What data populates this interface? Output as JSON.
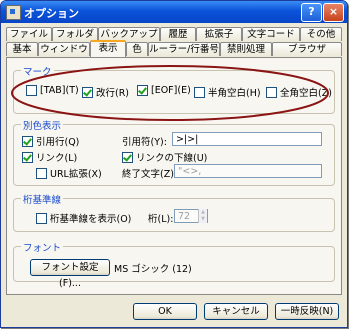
{
  "window": {
    "title": "オプション",
    "help_btn": "?",
    "close_btn": "×"
  },
  "tabs_row1": [
    "ファイル",
    "フォルダ",
    "バックアップ",
    "履歴",
    "拡張子",
    "文字コード",
    "その他"
  ],
  "tabs_row2": [
    "基本",
    "ウィンドウ",
    "表示",
    "色",
    "ルーラー/行番号",
    "禁則処理",
    "ブラウザ"
  ],
  "active_tab": "表示",
  "mark": {
    "legend": "マーク",
    "items": [
      {
        "label": "[TAB](T)",
        "checked": false
      },
      {
        "label": "改行(R)",
        "checked": true
      },
      {
        "label": "[EOF](E)",
        "checked": true
      },
      {
        "label": "半角空白(H)",
        "checked": false
      },
      {
        "label": "全角空白(Z)",
        "checked": false
      }
    ]
  },
  "color": {
    "legend": "別色表示",
    "quote_line": "引用行(Q)",
    "quote_line_checked": true,
    "quote_mark_label": "引用符(Y):",
    "quote_mark_value": ">|>|",
    "link": "リンク(L)",
    "link_checked": true,
    "link_underline": "リンクの下線(U)",
    "link_underline_checked": true,
    "url_ext": "URL拡張(X)",
    "url_ext_checked": false,
    "term_label": "終了文字(Z):",
    "term_value": "\"<>,"
  },
  "ruler": {
    "legend": "桁基準線",
    "show": "桁基準線を表示(O)",
    "show_checked": false,
    "col_label": "桁(L):",
    "col_value": "72"
  },
  "font": {
    "legend": "フォント",
    "button": "フォント設定(F)...",
    "current": "MS ゴシック (12)"
  },
  "footer": {
    "ok": "OK",
    "cancel": "キャンセル",
    "apply": "一時反映(N)"
  },
  "colors": {
    "title_bar": "#0a53d9",
    "legend_text": "#1a4bcc",
    "annotation": "#8b1414"
  }
}
